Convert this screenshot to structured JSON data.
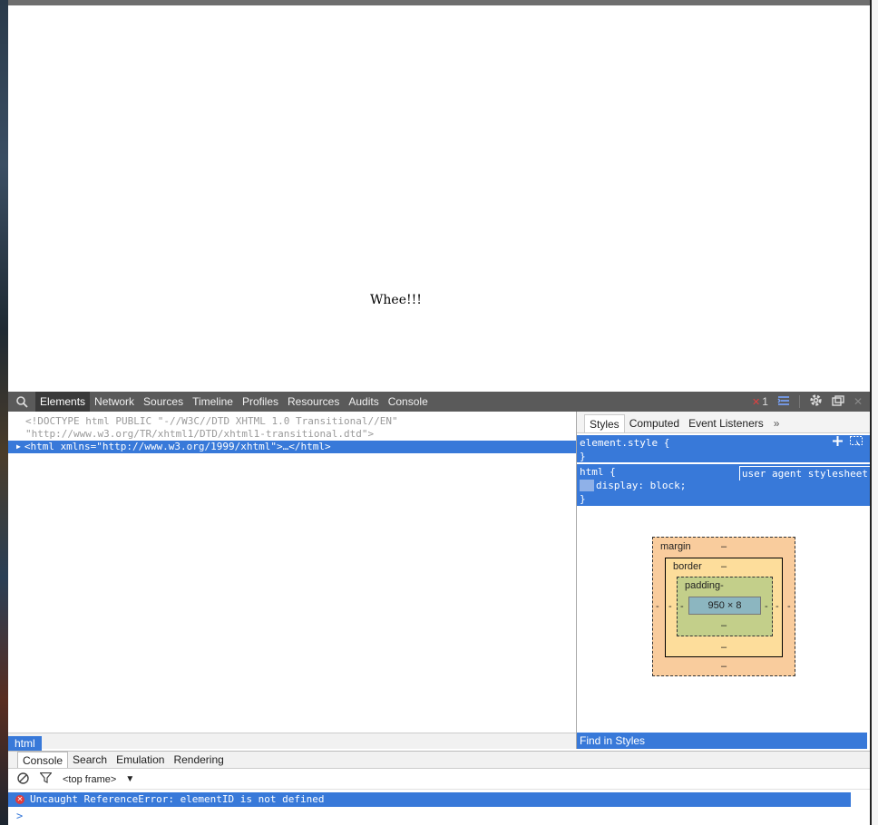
{
  "page": {
    "body_text": "Whee!!!"
  },
  "devtools": {
    "tabs": [
      {
        "label": "Elements"
      },
      {
        "label": "Network"
      },
      {
        "label": "Sources"
      },
      {
        "label": "Timeline"
      },
      {
        "label": "Profiles"
      },
      {
        "label": "Resources"
      },
      {
        "label": "Audits"
      },
      {
        "label": "Console"
      }
    ],
    "active_tab": "Elements",
    "error_count": "1",
    "icons": [
      "search-icon",
      "error-icon",
      "drawer-icon",
      "settings-icon",
      "dock-icon",
      "close-icon"
    ]
  },
  "elements": {
    "doctype_line1": "<!DOCTYPE html PUBLIC \"-//W3C//DTD XHTML 1.0 Transitional//EN\"",
    "doctype_line2": "\"http://www.w3.org/TR/xhtml1/DTD/xhtml1-transitional.dtd\">",
    "html_node": "<html xmlns=\"http://www.w3.org/1999/xhtml\">…</html>"
  },
  "sidebar": {
    "tabs": [
      {
        "label": "Styles"
      },
      {
        "label": "Computed"
      },
      {
        "label": "Event Listeners"
      }
    ],
    "more": "»",
    "element_style_open": "element.style {",
    "close_brace": "}",
    "html_rule_selector": "html {",
    "user_agent_label": "user agent stylesheet",
    "declaration": "display: block;",
    "find_in_styles": "Find in Styles"
  },
  "box_model": {
    "margin_label": "margin",
    "border_label": "border",
    "padding_label": "padding-",
    "content": "950 × 8",
    "dash": "–",
    "dash_small": "-"
  },
  "breadcrumb": {
    "item": "html"
  },
  "drawer": {
    "tabs": [
      {
        "label": "Console"
      },
      {
        "label": "Search"
      },
      {
        "label": "Emulation"
      },
      {
        "label": "Rendering"
      }
    ],
    "frame": "<top frame>",
    "error_message": "Uncaught ReferenceError: elementID is not defined",
    "prompt": ">"
  },
  "colors": {
    "selection": "#3879d9",
    "toolbar": "#5a5a5a",
    "margin": "#f9cc9d",
    "border": "#fddd9b",
    "padding": "#c3cf8a",
    "content": "#8cb6c0"
  }
}
